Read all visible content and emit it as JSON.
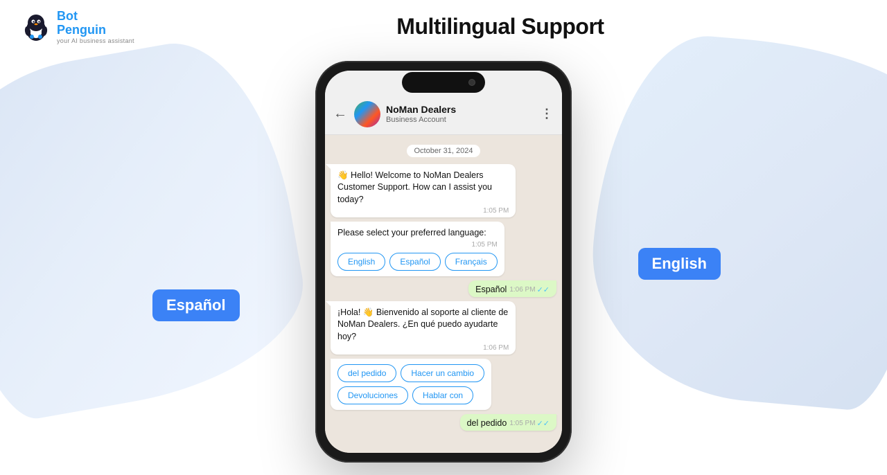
{
  "logo": {
    "title_bot": "Bot",
    "title_penguin": "Penguin",
    "subtitle": "your AI business assistant"
  },
  "page_title": "Multilingual Support",
  "chat": {
    "business_name": "NoMan Dealers",
    "business_account": "Business Account",
    "date_badge": "October 31, 2024",
    "messages": [
      {
        "type": "incoming",
        "text": "👋 Hello! Welcome to NoMan Dealers Customer Support. How can I assist you today?",
        "time": "1:05 PM"
      },
      {
        "type": "lang_select",
        "text": "Please select your preferred language:",
        "time": "1:05 PM",
        "options": [
          "English",
          "Español",
          "Français"
        ]
      },
      {
        "type": "outgoing",
        "text": "Español",
        "time": "1:06 PM",
        "ticks": "✓✓"
      },
      {
        "type": "incoming",
        "text": "¡Hola! 👋 Bienvenido al soporte al cliente de NoMan Dealers. ¿En qué puedo ayudarte hoy?",
        "time": "1:06 PM"
      },
      {
        "type": "lang_select2",
        "options_row1": [
          "del pedido",
          "Hacer un cambio"
        ],
        "options_row2": [
          "Devoluciones",
          "Hablar con"
        ]
      },
      {
        "type": "outgoing2",
        "text": "del pedido",
        "time": "1:05 PM",
        "ticks": "✓✓"
      }
    ]
  },
  "float_badges": {
    "english": "English",
    "espanol": "Español"
  }
}
